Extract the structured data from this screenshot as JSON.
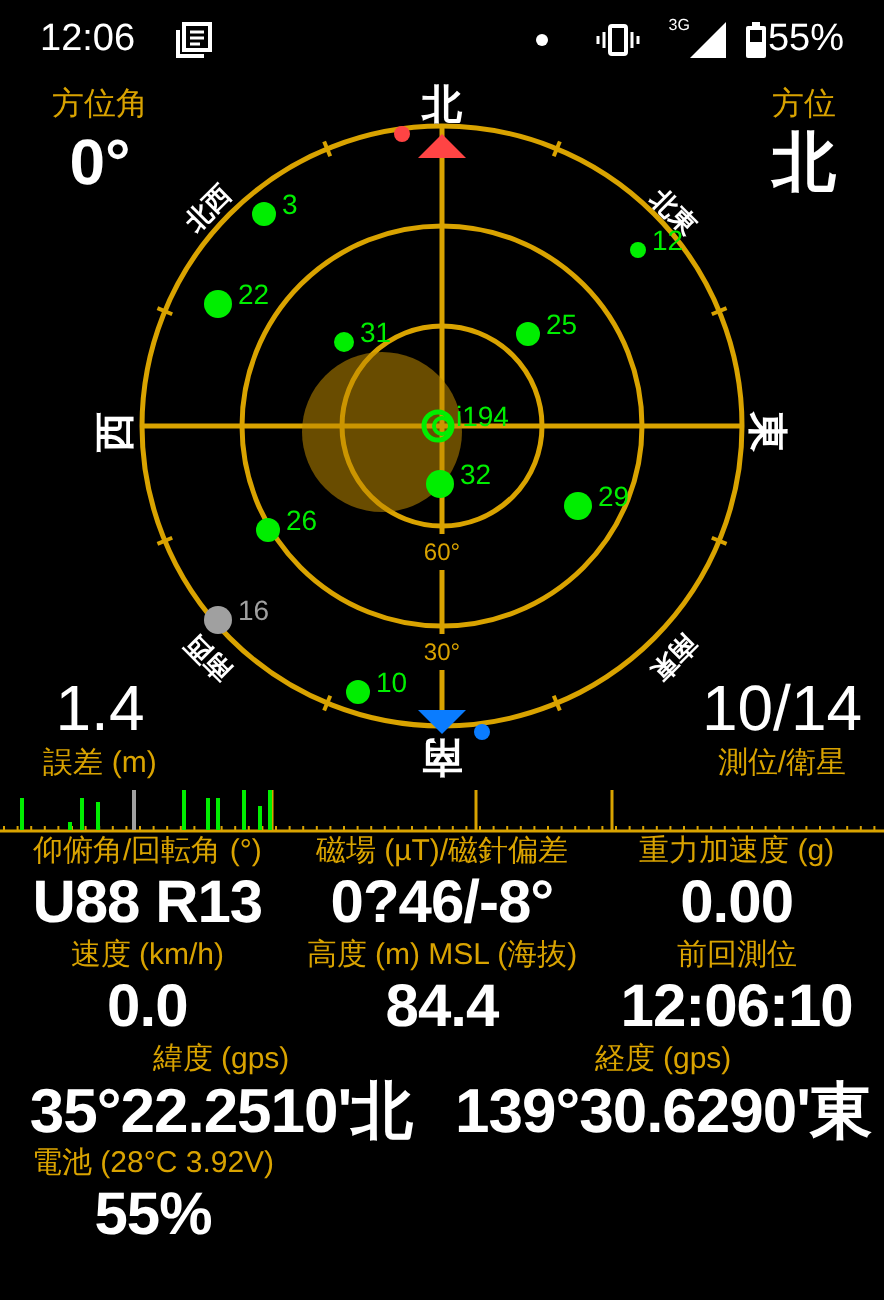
{
  "status_bar": {
    "time": "12:06",
    "network": "3G",
    "battery": "55%"
  },
  "compass": {
    "azimuth_label": "方位角",
    "azimuth_value": "0°",
    "direction_label": "方位",
    "direction_value": "北",
    "accuracy_value": "1.4",
    "accuracy_label": "誤差 (m)",
    "fix_value": "10/14",
    "fix_label": "測位/衛星",
    "directions": [
      "北",
      "北東",
      "東",
      "南東",
      "南",
      "南西",
      "西",
      "北西"
    ],
    "rings": [
      "60°",
      "30°"
    ],
    "satellites": [
      {
        "label": "3",
        "color": "#00ee00"
      },
      {
        "label": "12",
        "color": "#00ee00"
      },
      {
        "label": "22",
        "color": "#00ee00"
      },
      {
        "label": "31",
        "color": "#00ee00"
      },
      {
        "label": "25",
        "color": "#00ee00"
      },
      {
        "label": "i194",
        "color": "#00ee00"
      },
      {
        "label": "32",
        "color": "#00ee00"
      },
      {
        "label": "29",
        "color": "#00ee00"
      },
      {
        "label": "26",
        "color": "#00ee00"
      },
      {
        "label": "16",
        "color": "#a0a0a0"
      },
      {
        "label": "10",
        "color": "#00ee00"
      }
    ]
  },
  "readings": [
    [
      {
        "label": "仰俯角/回転角 (°)",
        "value": "U88 R13"
      },
      {
        "label": "磁場 (µT)/磁針偏差",
        "value": "0?46/-8°"
      },
      {
        "label": "重力加速度 (g)",
        "value": "0.00"
      }
    ],
    [
      {
        "label": "速度 (km/h)",
        "value": "0.0"
      },
      {
        "label": "高度 (m) MSL (海抜)",
        "value": "84.4"
      },
      {
        "label": "前回測位",
        "value": "12:06:10"
      }
    ],
    [
      {
        "label": "緯度 (gps)",
        "value": "35°22.2510'北"
      },
      {
        "label": "経度 (gps)",
        "value": "139°30.6290'東"
      }
    ],
    [
      {
        "label": "電池 (28°C 3.92V)",
        "value": "55%"
      }
    ]
  ]
}
